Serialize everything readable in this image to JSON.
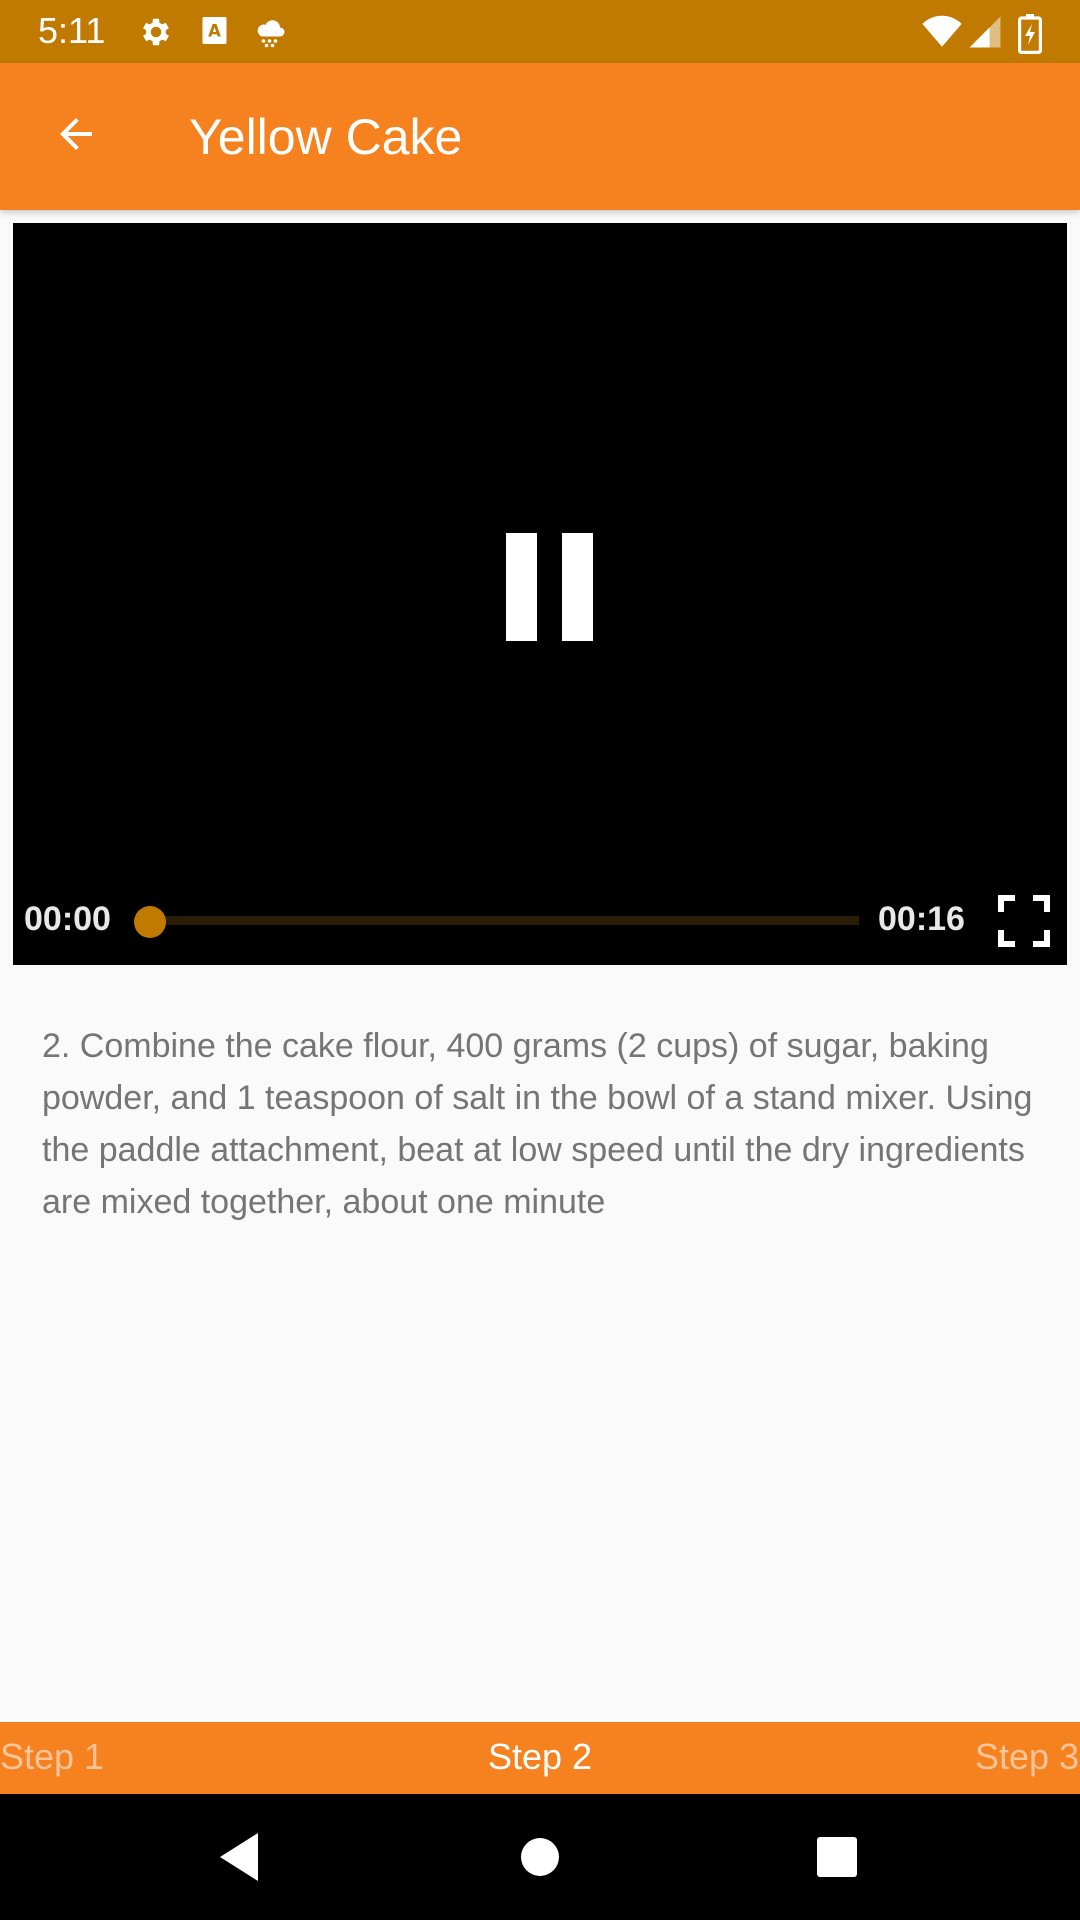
{
  "status_bar": {
    "time": "5:11",
    "left_icons": [
      "gear-icon",
      "font-a-icon",
      "weather-snow-icon"
    ],
    "right_icons": [
      "wifi-icon",
      "cell-signal-icon",
      "battery-charging-icon"
    ],
    "color": "#C17A00"
  },
  "app_bar": {
    "title": "Yellow Cake",
    "back_icon": "arrow-left-icon",
    "color": "#F5821F"
  },
  "video": {
    "current_time": "00:00",
    "total_time": "00:16",
    "progress": 0,
    "state_icon": "pause-icon",
    "fullscreen_icon": "fullscreen-icon",
    "accent_color": "#C17A00"
  },
  "step": {
    "description": "2. Combine the cake flour, 400 grams (2 cups) of sugar, baking powder, and 1 teaspoon of salt in the bowl of a stand mixer. Using the paddle attachment, beat at low speed until the dry ingredients are mixed together, about one minute"
  },
  "step_nav": {
    "prev_label": "Step 1",
    "current_label": "Step 2",
    "next_label": "Step 3"
  },
  "system_nav": {
    "icons": [
      "back-triangle-icon",
      "home-circle-icon",
      "recents-square-icon"
    ]
  }
}
